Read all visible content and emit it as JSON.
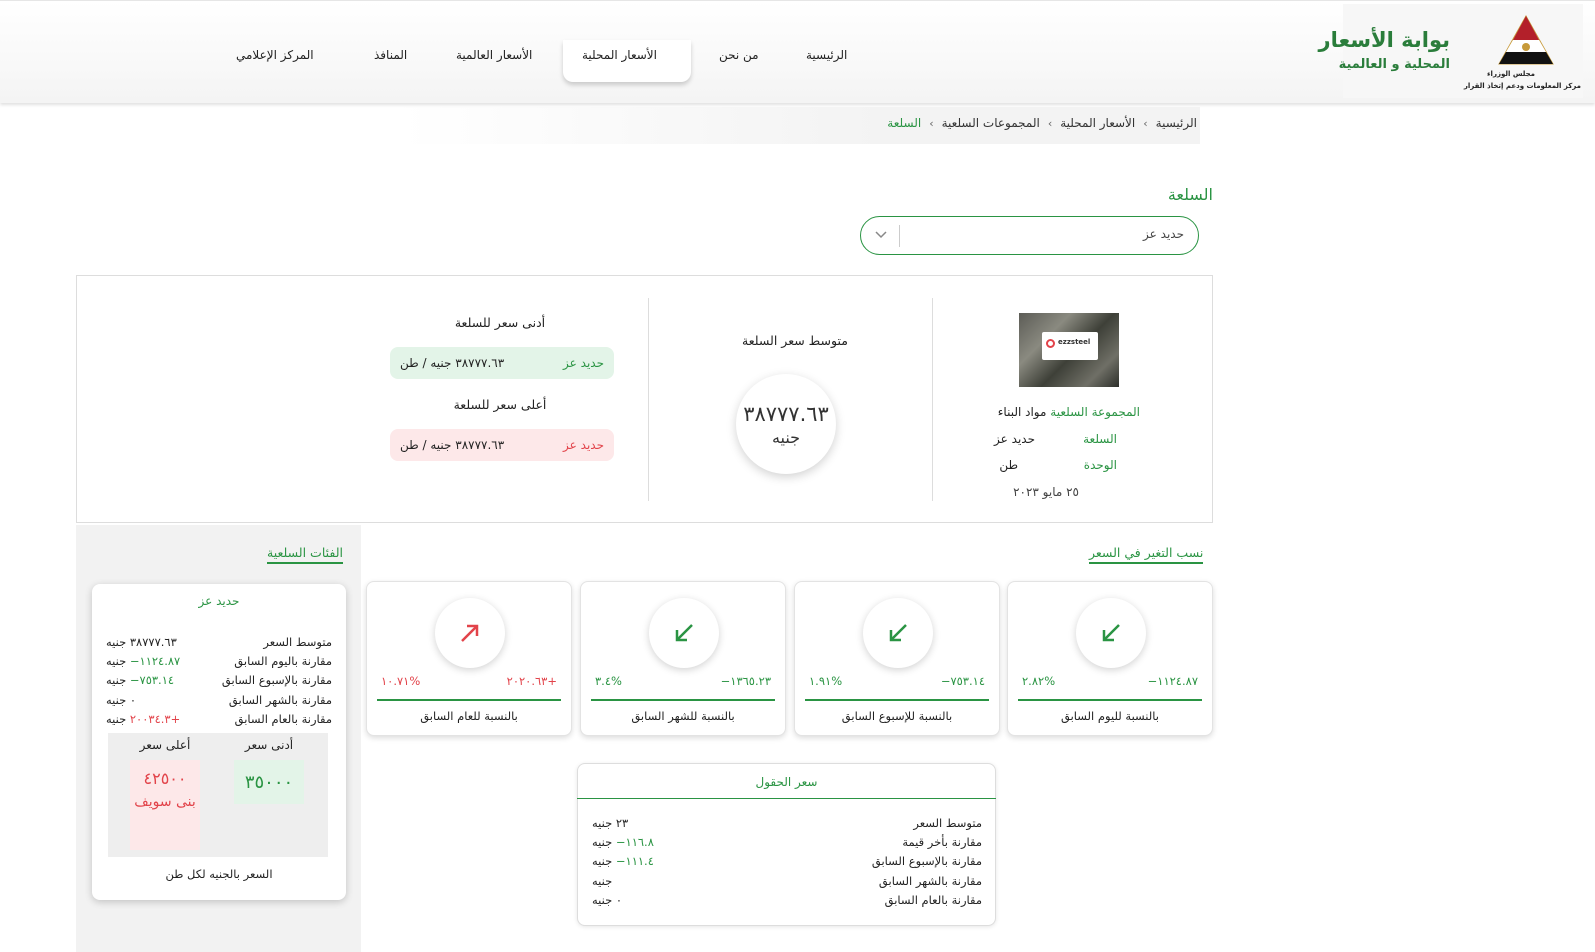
{
  "header": {
    "portal_title": "بوابة الأسعار",
    "portal_subtitle": "المحلية و العالمية",
    "cabinet_text": "مجلس الوزراء",
    "idsc_text": "مركز المعلومات ودعم إتخاذ القرار",
    "nav": [
      {
        "label": "الرئيسية",
        "active": false
      },
      {
        "label": "من نحن",
        "active": false
      },
      {
        "label": "الأسعار المحلية",
        "active": true
      },
      {
        "label": "الأسعار العالمية",
        "active": false
      },
      {
        "label": "المنافذ",
        "active": false
      },
      {
        "label": "المركز الإعلامي",
        "active": false
      }
    ]
  },
  "breadcrumb": [
    "الرئيسية",
    "الأسعار المحلية",
    "المجموعات السلعية",
    "السلعة"
  ],
  "selector": {
    "label": "السلعة",
    "value": "حديد عز"
  },
  "summary": {
    "image_logo_text": "ezzsteel",
    "group_label": "المجموعة السلعية",
    "group_value": "مواد البناء",
    "commodity_label": "السلعة",
    "commodity_value": "حديد عز",
    "unit_label": "الوحدة",
    "unit_value": "طن",
    "date": "٢٥ مايو ٢٠٢٣",
    "avg_title": "متوسط سعر السلعة",
    "avg_value": "٣٨٧٧٧.٦٣",
    "avg_unit": "جنيه",
    "min_title": "أدنى سعر للسلعة",
    "min_name": "حديد عز",
    "min_price": "٣٨٧٧٧.٦٣ جنيه / طن",
    "max_title": "أعلى سعر للسلعة",
    "max_name": "حديد عز",
    "max_price": "٣٨٧٧٧.٦٣ جنيه / طن"
  },
  "changes": {
    "title": "نسب التغير في السعر",
    "cards": [
      {
        "label": "بالنسبة لليوم السابق",
        "value": "١١٢٤.٨٧−",
        "percent": "%٢.٨٢",
        "direction": "down"
      },
      {
        "label": "بالنسبة للإسبوع السابق",
        "value": "٧٥٣.١٤−",
        "percent": "%١.٩١",
        "direction": "down"
      },
      {
        "label": "بالنسبة للشهر السابق",
        "value": "١٣٦٥.٢٣−",
        "percent": "%٣.٤",
        "direction": "down"
      },
      {
        "label": "بالنسبة للعام السابق",
        "value": "+٢٠٢٠.٦٣",
        "percent": "%١٠.٧١",
        "direction": "up"
      }
    ]
  },
  "categories": {
    "title": "الفئات السلعية",
    "card_title": "حديد عز",
    "rows": [
      {
        "label": "متوسط السعر",
        "value": "٣٨٧٧٧.٦٣ جنيه",
        "delta": ""
      },
      {
        "label": "مقارنة باليوم السابق",
        "value": "جنيه",
        "delta": "١١٢٤.٨٧−"
      },
      {
        "label": "مقارنة بالإسبوع السابق",
        "value": "جنيه",
        "delta": "٧٥٣.١٤−"
      },
      {
        "label": "مقارنة بالشهر السابق",
        "value": "٠ جنيه",
        "delta": ""
      },
      {
        "label": "مقارنة بالعام السابق",
        "value": "جنيه",
        "delta": "+٢٠٠٣٤.٣"
      }
    ],
    "min_label": "أدنى سعر",
    "min_value": "٣٥٠٠٠",
    "max_label": "أعلى سعر",
    "max_value": "٤٢٥٠٠",
    "max_location": "بنى سويف",
    "footer": "السعر بالجنيه لكل طن"
  },
  "fields": {
    "title": "سعر الحقول",
    "rows": [
      {
        "label": "متوسط السعر",
        "value": "٢٣ جنيه",
        "delta": ""
      },
      {
        "label": "مقارنة بأخر قيمة",
        "value": "جنيه",
        "delta": "١١٦.٨−"
      },
      {
        "label": "مقارنة بالإسبوع السابق",
        "value": "جنيه",
        "delta": "١١١.٤−"
      },
      {
        "label": "مقارنة بالشهر السابق",
        "value": "جنيه",
        "delta": ""
      },
      {
        "label": "مقارنة بالعام السابق",
        "value": "٠ جنيه",
        "delta": ""
      }
    ]
  },
  "colors": {
    "brand_green": "#2a9443",
    "down_green": "#2a9443",
    "up_red": "#e2434a"
  }
}
